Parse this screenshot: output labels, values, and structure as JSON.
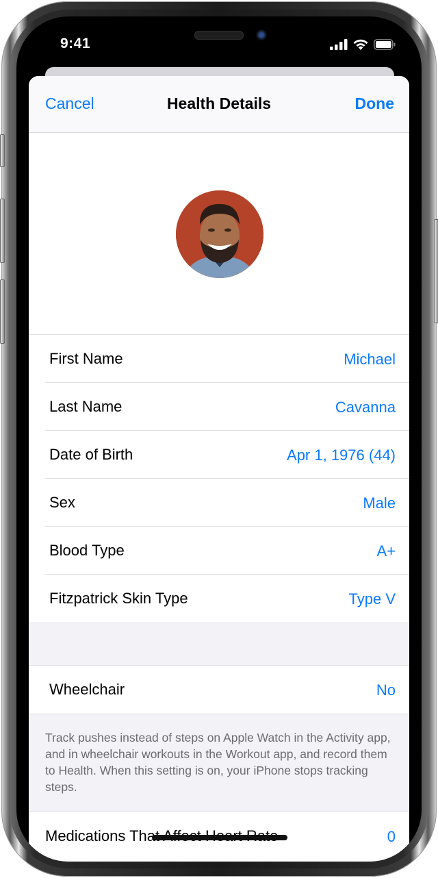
{
  "status_bar": {
    "time": "9:41",
    "icons": [
      "cellular-signal-icon",
      "wifi-icon",
      "battery-icon"
    ]
  },
  "nav": {
    "cancel_label": "Cancel",
    "title": "Health Details",
    "done_label": "Done"
  },
  "colors": {
    "accent": "#0a7aff",
    "grouped_background": "#f2f2f7",
    "secondary_text": "#6c6c70",
    "avatar_background": "#b5432a"
  },
  "profile": {
    "avatar_description": "profile photo of smiling man with beard"
  },
  "details": [
    {
      "label": "First Name",
      "value": "Michael"
    },
    {
      "label": "Last Name",
      "value": "Cavanna"
    },
    {
      "label": "Date of Birth",
      "value": "Apr 1, 1976 (44)"
    },
    {
      "label": "Sex",
      "value": "Male"
    },
    {
      "label": "Blood Type",
      "value": "A+"
    },
    {
      "label": "Fitzpatrick Skin Type",
      "value": "Type V"
    }
  ],
  "wheelchair": {
    "label": "Wheelchair",
    "value": "No",
    "footnote": "Track pushes instead of steps on Apple Watch in the Activity app, and in wheelchair workouts in the Workout app, and record them to Health. When this setting is on, your iPhone stops tracking steps."
  },
  "medications": {
    "label": "Medications That Affect Heart Rate",
    "value": "0"
  }
}
